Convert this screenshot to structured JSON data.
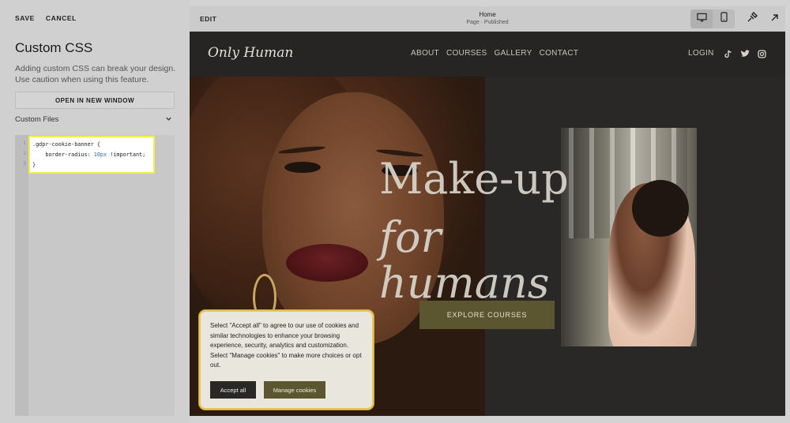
{
  "panel": {
    "save_label": "SAVE",
    "cancel_label": "CANCEL",
    "title": "Custom CSS",
    "description": "Adding custom CSS can break your design. Use caution when using this feature.",
    "open_window_label": "OPEN IN NEW WINDOW",
    "custom_files_label": "Custom Files",
    "gutter": [
      "1",
      "2",
      "3"
    ],
    "code": {
      "line1": ".gdpr-cookie-banner {",
      "line2_prop": "    border-radius: ",
      "line2_val": "10px",
      "line2_rest": " !important;",
      "line3": "}"
    }
  },
  "preview_bar": {
    "edit_label": "EDIT",
    "page_title": "Home",
    "page_status": "Page · Published"
  },
  "site": {
    "logo": "Only Human",
    "nav": [
      "ABOUT",
      "COURSES",
      "GALLERY",
      "CONTACT"
    ],
    "login": "LOGIN",
    "hero_title": "Make-up",
    "hero_subtitle": "for humans",
    "explore_label": "EXPLORE COURSES"
  },
  "cookie": {
    "text": "Select \"Accept all\" to agree to our use of cookies and similar technologies to enhance your browsing experience, security, analytics and customization. Select \"Manage cookies\" to make more choices or opt out.",
    "accept_label": "Accept all",
    "manage_label": "Manage cookies"
  },
  "colors": {
    "highlight_border": "#f2ef4c",
    "button_olive": "#5b5530",
    "site_bg": "#262524"
  }
}
